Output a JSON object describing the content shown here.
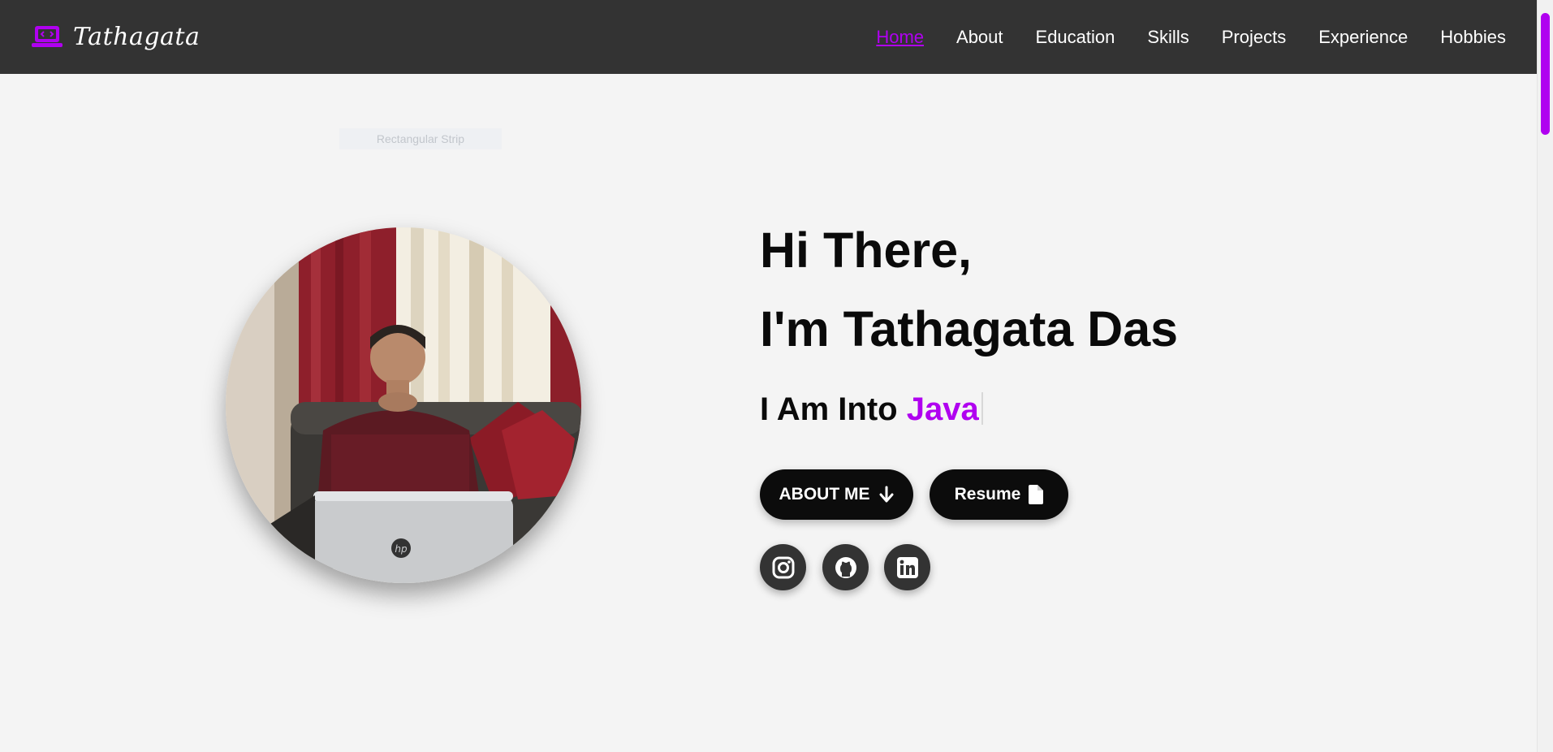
{
  "nav": {
    "brand": "Tathagata",
    "links": [
      {
        "label": "Home",
        "active": true
      },
      {
        "label": "About"
      },
      {
        "label": "Education"
      },
      {
        "label": "Skills"
      },
      {
        "label": "Projects"
      },
      {
        "label": "Experience"
      },
      {
        "label": "Hobbies"
      }
    ]
  },
  "hero": {
    "broken_image_alt": "Rectangular Strip",
    "greeting_line1": "Hi There,",
    "greeting_line2": "I'm Tathagata Das",
    "typed_prefix": "I Am Into ",
    "typed_word": "Java",
    "about_button": "ABOUT ME",
    "resume_button": "Resume"
  },
  "icons": {
    "brand": "laptop-code-icon",
    "about": "arrow-down-icon",
    "resume": "file-icon",
    "social": [
      "instagram-icon",
      "github-icon",
      "linkedin-icon"
    ]
  },
  "colors": {
    "accent": "#b000f0",
    "navbar": "#333333",
    "background": "#f4f4f4",
    "button": "#0c0c0c"
  }
}
